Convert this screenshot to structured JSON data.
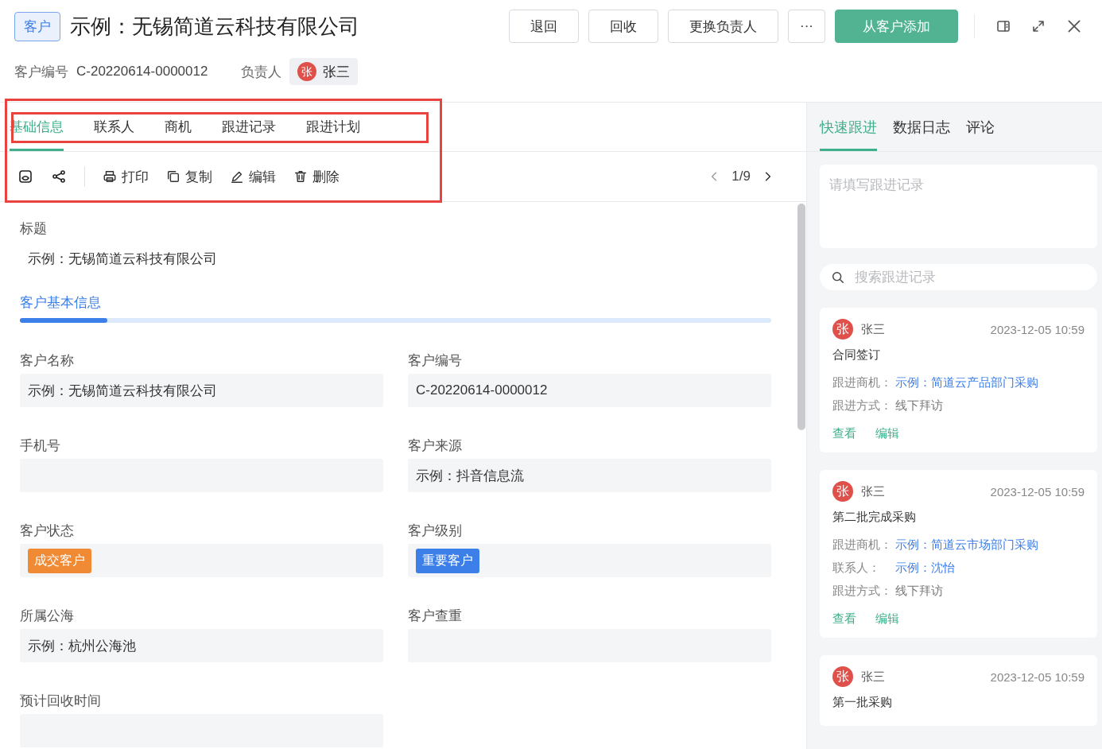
{
  "header": {
    "tag": "客户",
    "title": "示例：无锡简道云科技有限公司",
    "buttons": [
      {
        "label": "退回",
        "kind": "default"
      },
      {
        "label": "回收",
        "kind": "default"
      },
      {
        "label": "更换负责人",
        "kind": "default"
      },
      {
        "label": "···",
        "kind": "more"
      },
      {
        "label": "从客户添加",
        "kind": "primary"
      }
    ]
  },
  "meta": {
    "number_label": "客户编号",
    "number": "C-20220614-0000012",
    "owner_label": "负责人",
    "owner_avatar": "张",
    "owner_name": "张三"
  },
  "tabs": [
    {
      "label": "基础信息",
      "selected": true
    },
    {
      "label": "联系人",
      "selected": false
    },
    {
      "label": "商机",
      "selected": false
    },
    {
      "label": "跟进记录",
      "selected": false
    },
    {
      "label": "跟进计划",
      "selected": false
    }
  ],
  "toolbar": {
    "actions": [
      {
        "label": "打印"
      },
      {
        "label": "复制"
      },
      {
        "label": "编辑"
      },
      {
        "label": "删除"
      }
    ],
    "pager": "1/9"
  },
  "title_field": {
    "label": "标题",
    "value": "示例：无锡简道云科技有限公司"
  },
  "section": {
    "title": "客户基本信息"
  },
  "fields": [
    {
      "label": "客户名称",
      "kind": "text",
      "value": "示例：无锡简道云科技有限公司"
    },
    {
      "label": "客户编号",
      "kind": "text",
      "value": "C-20220614-0000012"
    },
    {
      "label": "手机号",
      "kind": "text"
    },
    {
      "label": "客户来源",
      "kind": "text",
      "value": "示例：抖音信息流"
    },
    {
      "label": "客户状态",
      "kind": "tag",
      "value": "成交客户",
      "color": "#f08a34"
    },
    {
      "label": "客户级别",
      "kind": "tag",
      "value": "重要客户",
      "color": "#3d7fe8"
    },
    {
      "label": "所属公海",
      "kind": "text",
      "value": "示例：杭州公海池"
    },
    {
      "label": "客户查重",
      "kind": "text"
    },
    {
      "label": "预计回收时间",
      "kind": "text"
    }
  ],
  "side": {
    "tabs": [
      {
        "label": "快速跟进",
        "selected": true
      },
      {
        "label": "数据日志",
        "selected": false
      },
      {
        "label": "评论",
        "selected": false
      }
    ],
    "note_placeholder": "请填写跟进记录",
    "search_placeholder": "搜索跟进记录",
    "records": [
      {
        "avatar": "张",
        "name": "张三",
        "time": "2023-12-05 10:59",
        "title": "合同签订",
        "details": [
          {
            "label": "跟进商机：",
            "value": "示例：简道云产品部门采购",
            "link": true
          },
          {
            "label": "跟进方式：",
            "value": "线下拜访",
            "link": false
          }
        ],
        "actions": [
          "查看",
          "编辑"
        ]
      },
      {
        "avatar": "张",
        "name": "张三",
        "time": "2023-12-05 10:59",
        "title": "第二批完成采购",
        "details": [
          {
            "label": "跟进商机：",
            "value": "示例：简道云市场部门采购",
            "link": true
          },
          {
            "label": "联系人：",
            "value": "示例：沈怡",
            "link": true
          },
          {
            "label": "跟进方式：",
            "value": "线下拜访",
            "link": false
          }
        ],
        "actions": [
          "查看",
          "编辑"
        ]
      },
      {
        "avatar": "张",
        "name": "张三",
        "time": "2023-12-05 10:59",
        "title": "第一批采购"
      }
    ]
  }
}
